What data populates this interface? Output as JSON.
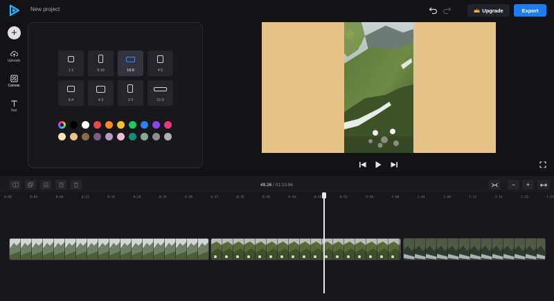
{
  "app": {
    "project_name": "New project"
  },
  "header": {
    "upgrade_label": "Upgrade",
    "export_label": "Export"
  },
  "sidebar": {
    "items": [
      {
        "label": "Uploads",
        "icon": "upload-cloud-icon"
      },
      {
        "label": "Canvas",
        "icon": "canvas-icon"
      },
      {
        "label": "Text",
        "icon": "text-icon"
      }
    ]
  },
  "canvas": {
    "aspect_ratios": [
      {
        "label": "1:1",
        "selected": false
      },
      {
        "label": "9:16",
        "selected": false
      },
      {
        "label": "16:9",
        "selected": true
      },
      {
        "label": "4:5",
        "selected": false
      },
      {
        "label": "5:4",
        "selected": false
      },
      {
        "label": "4:3",
        "selected": false
      },
      {
        "label": "2:3",
        "selected": false
      },
      {
        "label": "21:9",
        "selected": false
      }
    ],
    "colors_row1": [
      "#000000",
      "#ffffff",
      "#e5484d",
      "#f08c2b",
      "#f5c12b",
      "#22c55e",
      "#2f80ed",
      "#8e44e6",
      "#e5377a"
    ],
    "colors_row2": [
      "#fbe3b8",
      "#e5c389",
      "#8b6a4a",
      "#7b5e86",
      "#b59bc5",
      "#f3bcd2",
      "#178a7a",
      "#8aa89a",
      "#8c8c92",
      "#b0b0b5"
    ],
    "background_color": "#e5c389"
  },
  "timeline": {
    "current_time": "49.26",
    "separator": "/",
    "duration": "01:23.96",
    "ruler": [
      "0:00",
      "0:04",
      "0:08",
      "0:12",
      "0:16",
      "0:20",
      "0:24",
      "0:28",
      "0:32",
      "0:36",
      "0:40",
      "0:44",
      "0:48",
      "0:52",
      "0:56",
      "1:00",
      "1:04",
      "1:08",
      "1:12",
      "1:16",
      "1:20",
      "1:24"
    ],
    "zoom_out": "−",
    "zoom_in": "+"
  }
}
